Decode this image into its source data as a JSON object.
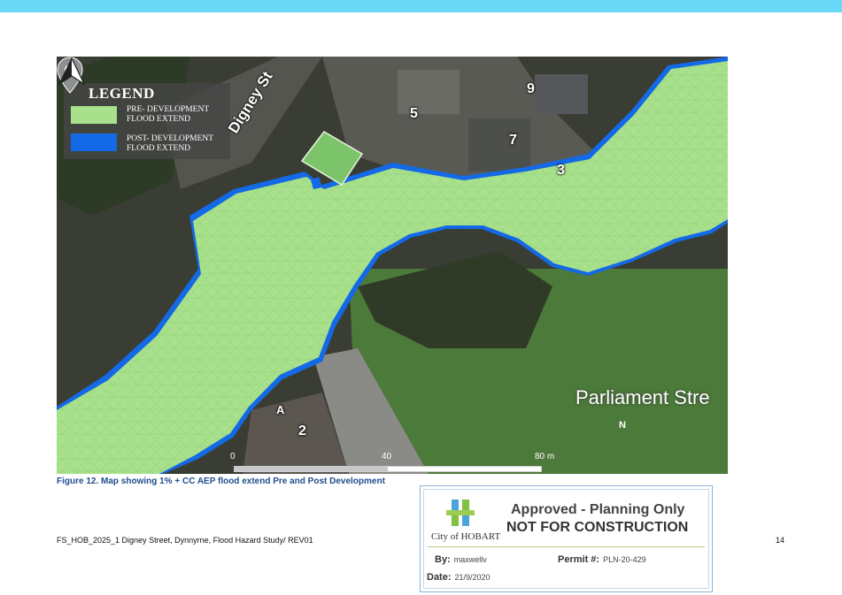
{
  "map": {
    "legend": {
      "title": "LEGEND",
      "items": [
        {
          "label": "PRE- DEVELOPMENT FLOOD EXTEND",
          "color": "#a8e08c"
        },
        {
          "label": "POST- DEVELOPMENT FLOOD EXTEND",
          "color": "#1469e6"
        }
      ]
    },
    "road_label": "Digney St",
    "house_numbers": [
      "9",
      "5",
      "7",
      "3",
      "2",
      "A"
    ],
    "place_label": "Parliament Stre",
    "scale": {
      "start": "0",
      "mid": "40",
      "end": "80 m"
    },
    "north": "N",
    "colors": {
      "imagery_dark": "#3a3d34",
      "park_grass": "#4c7a3a",
      "pre_flood": "#a8e08c",
      "post_flood": "#1469e6"
    }
  },
  "caption": "Figure 12. Map showing 1% + CC AEP flood extend Pre and Post Development",
  "footer": {
    "document": "FS_HOB_2025_1 Digney Street, Dynnyrne, Flood Hazard Study/ REV01",
    "page_number": "14"
  },
  "stamp": {
    "logo": "City of HOBART",
    "line1": "Approved - Planning Only",
    "line2": "NOT FOR CONSTRUCTION",
    "by_label": "By:",
    "by_value": "maxwellv",
    "permit_label": "Permit #:",
    "permit_value": "PLN-20-429",
    "date_label": "Date:",
    "date_value": "21/9/2020"
  }
}
